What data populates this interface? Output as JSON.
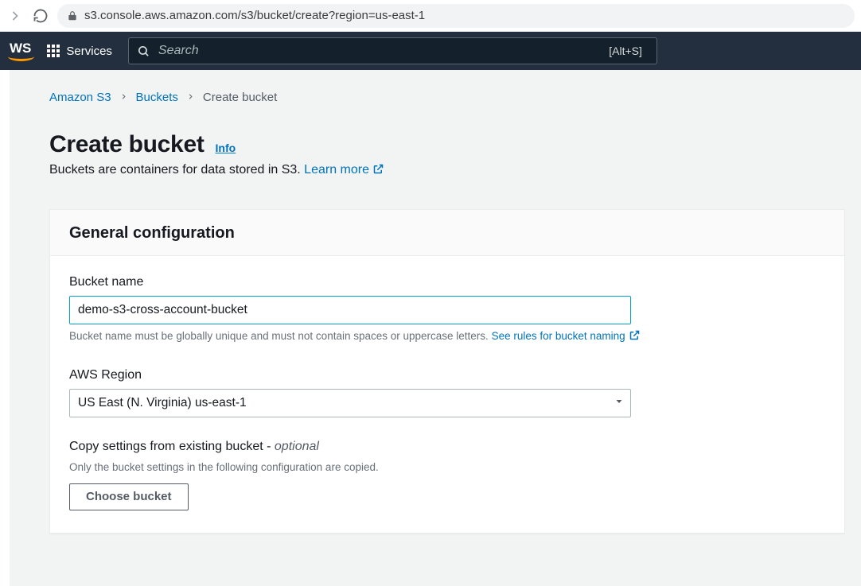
{
  "browser": {
    "url": "s3.console.aws.amazon.com/s3/bucket/create?region=us-east-1"
  },
  "nav": {
    "logo_fragment": "WS",
    "services_label": "Services",
    "search_placeholder": "Search",
    "shortcut_hint": "[Alt+S]"
  },
  "breadcrumb": {
    "items": [
      {
        "label": "Amazon S3",
        "link": true
      },
      {
        "label": "Buckets",
        "link": true
      },
      {
        "label": "Create bucket",
        "link": false
      }
    ]
  },
  "header": {
    "title": "Create bucket",
    "info_label": "Info",
    "subtitle_text": "Buckets are containers for data stored in S3. ",
    "learn_more_label": "Learn more"
  },
  "panel": {
    "title": "General configuration",
    "bucket_name": {
      "label": "Bucket name",
      "value": "demo-s3-cross-account-bucket",
      "helper_text": "Bucket name must be globally unique and must not contain spaces or uppercase letters. ",
      "rules_link_label": "See rules for bucket naming"
    },
    "region": {
      "label": "AWS Region",
      "selected": "US East (N. Virginia) us-east-1"
    },
    "copy_settings": {
      "label_main": "Copy settings from existing bucket - ",
      "label_optional": "optional",
      "helper_text": "Only the bucket settings in the following configuration are copied.",
      "button_label": "Choose bucket"
    }
  }
}
